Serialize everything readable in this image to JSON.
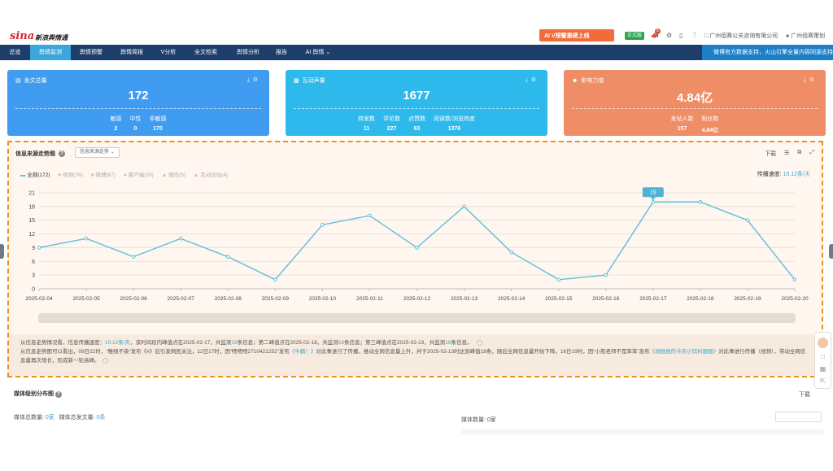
{
  "header": {
    "logo_main": "sina",
    "logo_sub": "新浪舆情通",
    "promo": "AI V预警重磅上线",
    "trial": "正式版",
    "badge": "6",
    "company": "广州佰赛公关咨询有限公司",
    "user": "广州佰赛策划",
    "icons": [
      "megaphone-icon",
      "gear-icon",
      "mobile-icon",
      "help-icon"
    ]
  },
  "nav": {
    "items": [
      "总览",
      "舆情监测",
      "舆情预警",
      "舆情简报",
      "V分析",
      "全文检索",
      "舆情分析",
      "报告",
      "AI 舆情"
    ],
    "active": "舆情监测",
    "notice": "微博官方数据支持，火山引擎全量内容同源支持"
  },
  "cards": {
    "posts": {
      "title": "发文总量",
      "value": "172",
      "stats": [
        {
          "label": "敏感",
          "value": "2"
        },
        {
          "label": "中性",
          "value": "0"
        },
        {
          "label": "非敏感",
          "value": "170"
        }
      ]
    },
    "interact": {
      "title": "互动声量",
      "value": "1677",
      "stats": [
        {
          "label": "转发数",
          "value": "11"
        },
        {
          "label": "评论数",
          "value": "227"
        },
        {
          "label": "点赞数",
          "value": "63"
        },
        {
          "label": "阅读数/浏览热度",
          "value": "1376"
        }
      ]
    },
    "influence": {
      "title": "影响力值",
      "value": "4.84亿",
      "stats": [
        {
          "label": "发帖人数",
          "value": "157"
        },
        {
          "label": "粉丝数",
          "value": "4.84亿"
        }
      ]
    }
  },
  "trend": {
    "title": "信息来源走势图",
    "dropdown": "信息来源走势",
    "tools": {
      "download": "下载"
    },
    "legend": [
      "全部(172)",
      "视频(76)",
      "微博(67)",
      "客户端(20)",
      "微信(5)",
      "互动论坛(4)"
    ],
    "speed_label": "传播速度:",
    "speed_value": "10.12条/天",
    "notes": {
      "n1a": "从信息走势情况看，信息传播速度：",
      "n1b": "10.12条/天",
      "n1c": "，该时间段内峰值点在2025-02-17，共监测",
      "n1d": "19",
      "n1e": "条信息；第二峰值点在2025-02-18，共监测",
      "n1f": "19",
      "n1g": "条信息；第三峰值点在2025-02-13，共监测",
      "n1h": "18",
      "n1i": "条信息。",
      "n2a": "从信息走势图可以看出，09日22时，“稚贱不染”发布《#》后引发网民关注，12日17时，因“啧啧啧2710421252”发布",
      "n2b": "《牛腩！》",
      "n2c": "对此事进行了传播，推动全网信息量上升，并于2025-02-13时达到峰值18条，随后全网信息量开始下降。16日19时，因“小熊老师不是笨笨”发布",
      "n2d": "《胡姐姐的卡买小饮料跟跟》",
      "n2e": "对此事进行传播",
      "n2f": "（视频），带动全网信息量再次增长，形成新一轮高峰。"
    }
  },
  "chart_data": {
    "type": "line",
    "x": [
      "2025-02-04",
      "2025-02-05",
      "2025-02-06",
      "2025-02-07",
      "2025-02-08",
      "2025-02-09",
      "2025-02-10",
      "2025-02-11",
      "2025-02-12",
      "2025-02-13",
      "2025-02-14",
      "2025-02-15",
      "2025-02-16",
      "2025-02-17",
      "2025-02-18",
      "2025-02-19",
      "2025-02-20"
    ],
    "series": [
      {
        "name": "全部(172)",
        "values": [
          9,
          11,
          7,
          11,
          7,
          2,
          14,
          16,
          9,
          18,
          8,
          2,
          3,
          19,
          19,
          15,
          2
        ]
      }
    ],
    "ylim": [
      0,
      21
    ],
    "yticks": [
      0,
      3,
      6,
      9,
      12,
      15,
      18,
      21
    ],
    "highlight": {
      "index": 13,
      "label": "19"
    },
    "color": "#5bbfd9",
    "grid": true
  },
  "media": {
    "title": "媒体级别分布图",
    "download": "下载",
    "total_media_label": "媒体总数量:",
    "total_media": "0家",
    "total_posts_label": "媒体总发文量:",
    "total_posts": "0条",
    "media_count_label": "媒体数量:",
    "media_count": "0家"
  }
}
